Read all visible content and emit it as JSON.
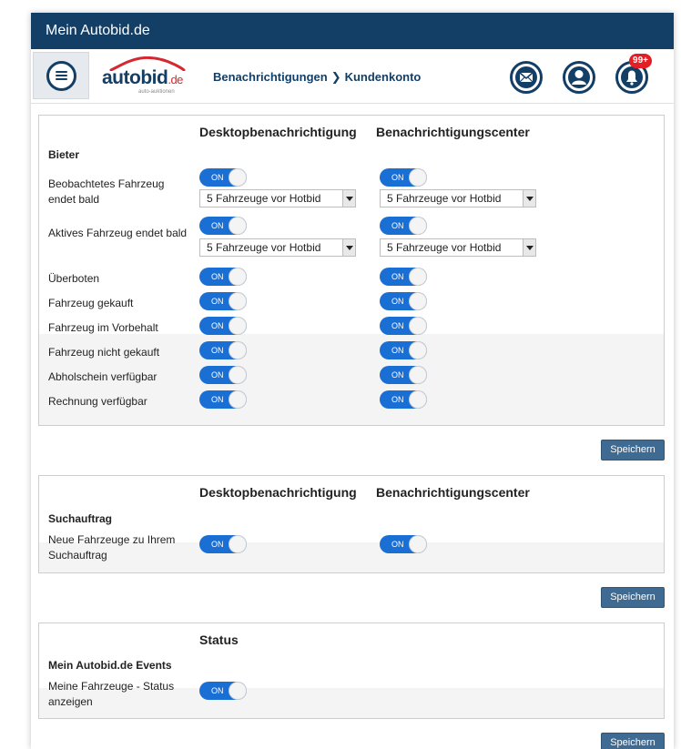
{
  "app": {
    "title": "Mein Autobid.de"
  },
  "header": {
    "logo_text": "autobid",
    "logo_suffix": ".de",
    "logo_subtitle": "auto-auktionen",
    "breadcrumb": [
      "Benachrichtigungen",
      "Kundenkonto"
    ],
    "notification_badge": "99+",
    "icons": [
      "menu-icon",
      "mail-icon",
      "user-icon",
      "bell-icon"
    ]
  },
  "columns": {
    "desktop": "Desktopbenachrichtigung",
    "center": "Benachrichtigungscenter"
  },
  "bieter": {
    "title": "Bieter",
    "rows": [
      {
        "label": "Beobachtetes Fahrzeug endet bald",
        "desktop": "ON",
        "center": "ON",
        "desktop_select": "5 Fahrzeuge vor Hotbid",
        "center_select": "5 Fahrzeuge vor Hotbid"
      },
      {
        "label": "Aktives Fahrzeug endet bald",
        "desktop": "ON",
        "center": "ON",
        "desktop_select": "5 Fahrzeuge vor Hotbid",
        "center_select": "5 Fahrzeuge vor Hotbid"
      },
      {
        "label": "Überboten",
        "desktop": "ON",
        "center": "ON"
      },
      {
        "label": "Fahrzeug gekauft",
        "desktop": "ON",
        "center": "ON"
      },
      {
        "label": "Fahrzeug im Vorbehalt",
        "desktop": "ON",
        "center": "ON"
      },
      {
        "label": "Fahrzeug nicht gekauft",
        "desktop": "ON",
        "center": "ON"
      },
      {
        "label": "Abholschein verfügbar",
        "desktop": "ON",
        "center": "ON"
      },
      {
        "label": "Rechnung verfügbar",
        "desktop": "ON",
        "center": "ON"
      }
    ]
  },
  "suchauftrag": {
    "title": "Suchauftrag",
    "rows": [
      {
        "label": "Neue Fahrzeuge zu Ihrem Suchauftrag",
        "desktop": "ON",
        "center": "ON"
      }
    ]
  },
  "status": {
    "heading": "Status",
    "title": "Mein Autobid.de Events",
    "rows": [
      {
        "label": "Meine Fahrzeuge - Status anzeigen",
        "status": "ON"
      }
    ]
  },
  "buttons": {
    "save": "Speichern"
  },
  "colors": {
    "nav": "#133e66",
    "toggle": "#1a6fd4",
    "button": "#3f6b93",
    "badge": "#e31e24"
  }
}
